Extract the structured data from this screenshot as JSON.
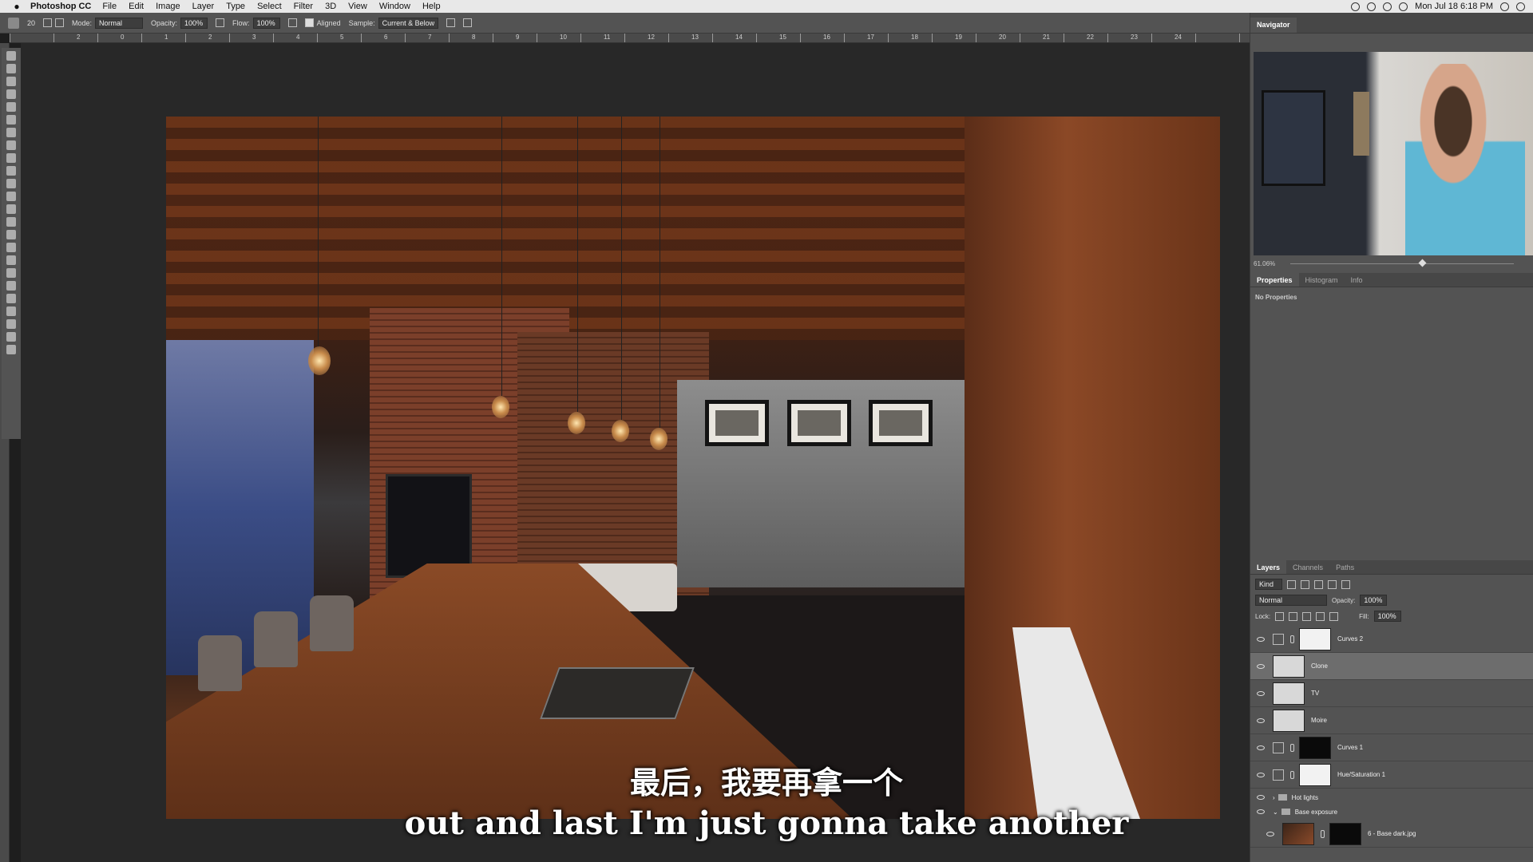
{
  "menubar": {
    "app_name": "Photoshop CC",
    "menus": [
      "File",
      "Edit",
      "Image",
      "Layer",
      "Type",
      "Select",
      "Filter",
      "3D",
      "View",
      "Window",
      "Help"
    ],
    "clock": "Mon Jul 18  6:18 PM"
  },
  "options_bar": {
    "brush_size": "20",
    "mode_label": "Mode:",
    "mode_value": "Normal",
    "opacity_label": "Opacity:",
    "opacity_value": "100%",
    "flow_label": "Flow:",
    "flow_value": "100%",
    "aligned_label": "Aligned",
    "aligned_checked": true,
    "sample_label": "Sample:",
    "sample_value": "Current & Below"
  },
  "ruler": {
    "labels": [
      "2",
      "0",
      "1",
      "2",
      "3",
      "4",
      "5",
      "6",
      "7",
      "8",
      "9",
      "10",
      "11",
      "12",
      "13",
      "14",
      "15",
      "16",
      "17",
      "18",
      "19",
      "20",
      "21",
      "22",
      "23",
      "24"
    ]
  },
  "tools": [
    "move-tool",
    "marquee-tool",
    "lasso-tool",
    "quick-select-tool",
    "crop-tool",
    "eyedropper-tool",
    "healing-tool",
    "brush-tool",
    "clone-stamp-tool",
    "history-brush-tool",
    "eraser-tool",
    "gradient-tool",
    "blur-tool",
    "sharpen-tool",
    "dodge-tool",
    "type-tool",
    "pen-tool",
    "path-select-tool",
    "hand-tool",
    "zoom-tool",
    "more-tools",
    "color-swatches",
    "quick-mask",
    "screen-mode"
  ],
  "subtitles": {
    "chinese": "最后，我要再拿一个",
    "english": "out and last I'm just gonna take another"
  },
  "navigator": {
    "tab": "Navigator",
    "zoom": "61.06%",
    "zoom_level": 0.58
  },
  "properties": {
    "tabs": [
      "Properties",
      "Histogram",
      "Info"
    ],
    "body": "No Properties"
  },
  "layers_panel": {
    "tabs": [
      "Layers",
      "Channels",
      "Paths"
    ],
    "filter_label": "Kind",
    "blend_mode": "Normal",
    "opacity_label": "Opacity:",
    "opacity_value": "100%",
    "lock_label": "Lock:",
    "fill_label": "Fill:",
    "fill_value": "100%",
    "layers": [
      {
        "name": "Curves 2",
        "type": "adjustment",
        "selected": false
      },
      {
        "name": "Clone",
        "type": "pixel",
        "selected": true
      },
      {
        "name": "TV",
        "type": "pixel",
        "selected": false
      },
      {
        "name": "Moire",
        "type": "pixel",
        "selected": false
      },
      {
        "name": "Curves 1",
        "type": "adjustment",
        "selected": false
      },
      {
        "name": "Hue/Saturation 1",
        "type": "adjustment",
        "selected": false
      }
    ],
    "groups": [
      {
        "name": "Hot lights",
        "expanded": false
      },
      {
        "name": "Base exposure",
        "expanded": true
      }
    ],
    "group_layer": {
      "name": "6 - Base dark.jpg"
    }
  },
  "colors": {
    "panel_bg": "#535353",
    "canvas_bg": "#282828",
    "menubar_bg": "#e8e8e8",
    "selected_row": "#6d6d6d"
  }
}
